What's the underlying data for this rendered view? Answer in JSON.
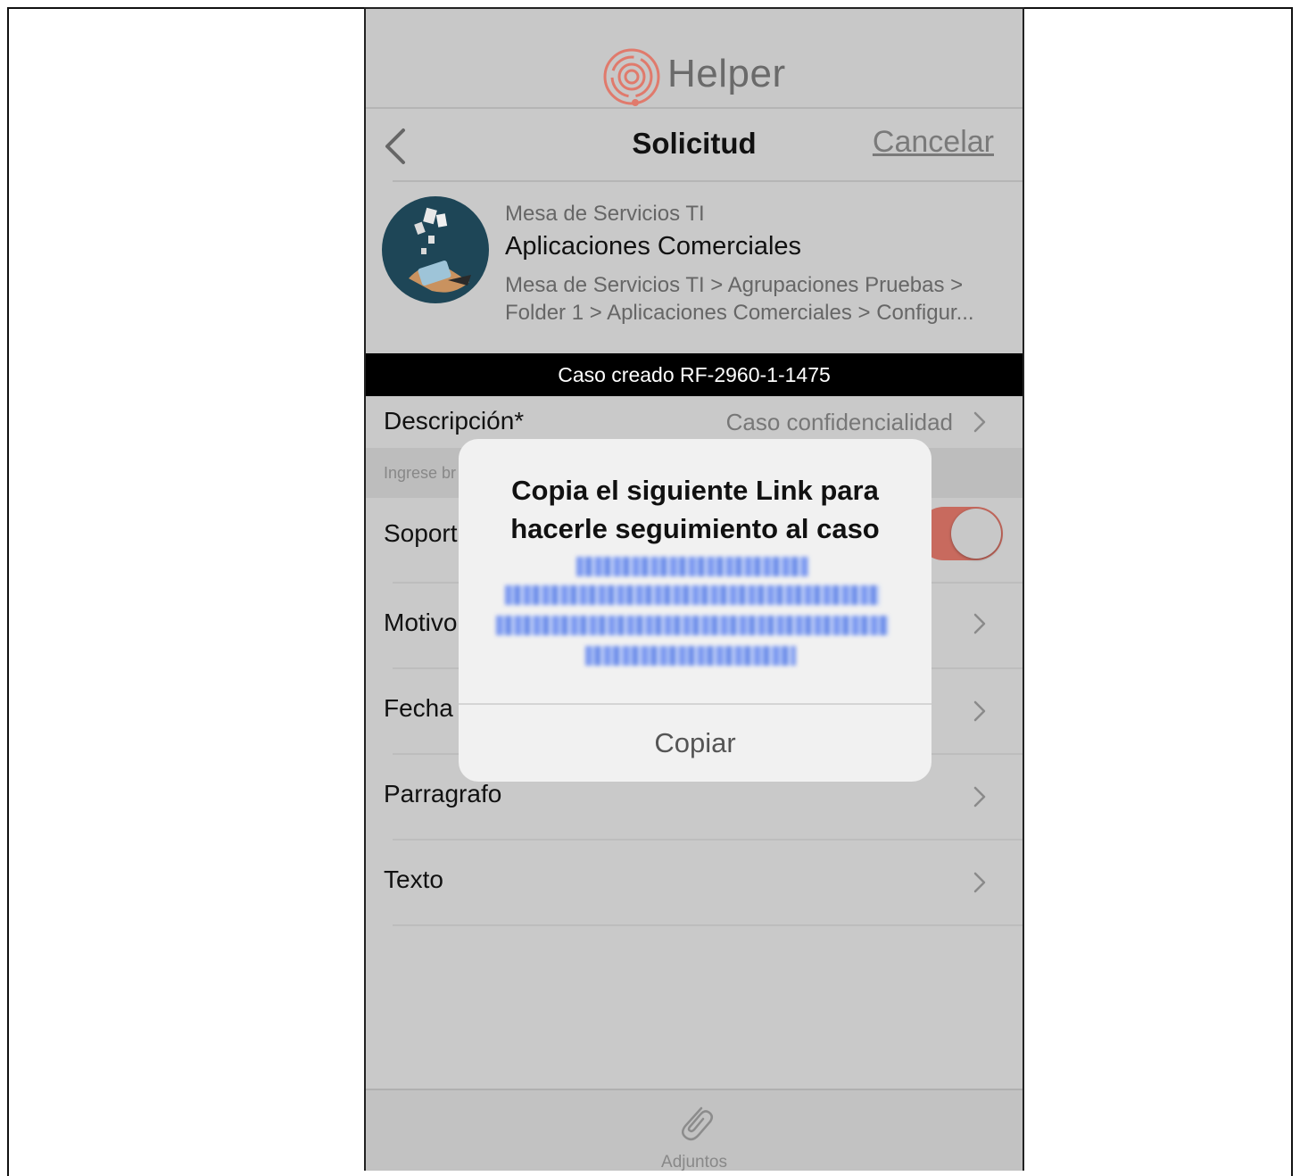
{
  "app": {
    "logo_text": "Helper"
  },
  "navbar": {
    "title": "Solicitud",
    "cancel_label": "Cancelar"
  },
  "service": {
    "group": "Mesa de Servicios TI",
    "name": "Aplicaciones Comerciales",
    "path_line1": "Mesa de Servicios TI > Agrupaciones Pruebas >",
    "path_line2": "Folder 1 > Aplicaciones Comerciales > Configur..."
  },
  "toast": {
    "text": "Caso creado RF-2960-1-1475"
  },
  "form": {
    "descripcion_label": "Descripción*",
    "descripcion_value": "Caso confidencialidad",
    "hint": "Ingrese br",
    "soporte_label": "Soport",
    "motivo_label": "Motivo",
    "fecha_label": "Fecha",
    "parragrafo_label": "Parragrafo",
    "texto_label": "Texto",
    "soporte_toggle_on": true
  },
  "dialog": {
    "title": "Copia el siguiente Link para hacerle seguimiento al caso",
    "button_label": "Copiar"
  },
  "footer": {
    "attachments_label": "Adjuntos"
  },
  "colors": {
    "toggle_on": "#c86a5e",
    "logo_accent": "#e07a6c",
    "toast_bg": "#000000"
  }
}
